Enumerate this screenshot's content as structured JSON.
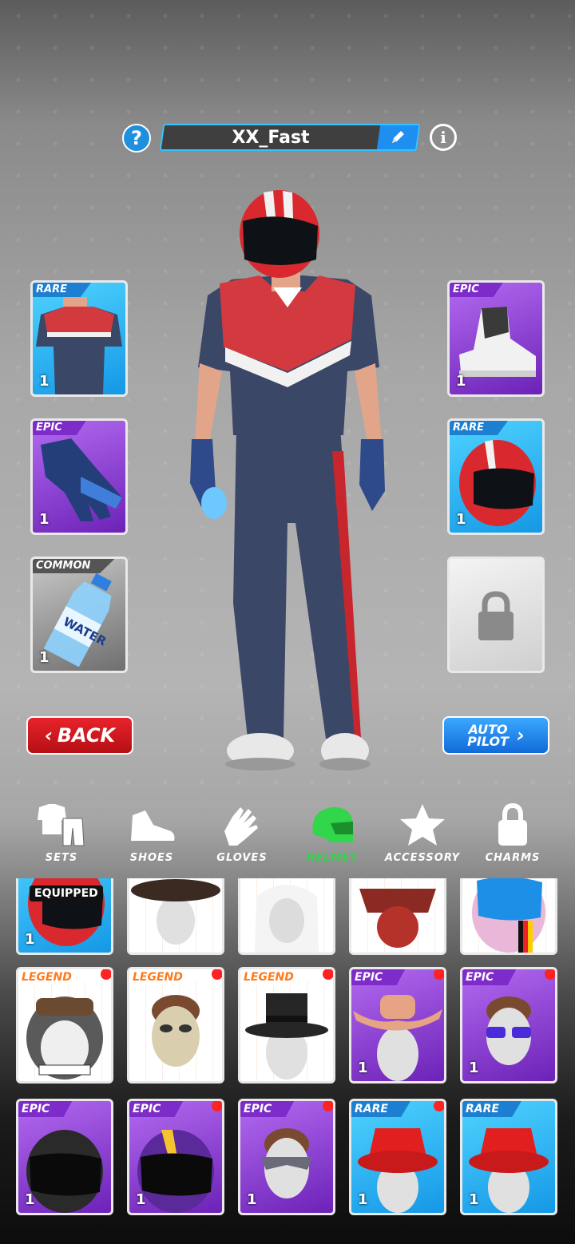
{
  "header": {
    "help_icon": "question-icon",
    "player_name": "XX_Fast",
    "edit_icon": "pencil-icon",
    "info_icon": "info-icon"
  },
  "equipped_slots": {
    "left": [
      {
        "rarity": "RARE",
        "count": "1",
        "item": "racing-suit"
      },
      {
        "rarity": "EPIC",
        "count": "1",
        "item": "glove"
      },
      {
        "rarity": "COMMON",
        "count": "1",
        "item": "water-bottle",
        "bottle_text": "WATER"
      }
    ],
    "right": [
      {
        "rarity": "EPIC",
        "count": "1",
        "item": "sneaker"
      },
      {
        "rarity": "RARE",
        "count": "1",
        "item": "helmet"
      },
      {
        "locked": true,
        "icon": "lock-icon"
      }
    ]
  },
  "buttons": {
    "back": "BACK",
    "autopilot_line1": "AUTO",
    "autopilot_line2": "PILOT"
  },
  "tabs": [
    {
      "label": "SETS",
      "icon": "sets-icon"
    },
    {
      "label": "SHOES",
      "icon": "shoe-icon"
    },
    {
      "label": "GLOVES",
      "icon": "glove-icon"
    },
    {
      "label": "HELMET",
      "icon": "helmet-icon",
      "active": true
    },
    {
      "label": "ACCESSORY",
      "icon": "star-icon"
    },
    {
      "label": "CHARMS",
      "icon": "lock-icon"
    }
  ],
  "colors": {
    "active_tab": "#31d64a",
    "rare": "#1598e6",
    "epic": "#7d2cc9",
    "legend": "#ff7a1a",
    "back": "#e8232a",
    "autopilot": "#1e8ef0"
  },
  "inventory": {
    "row0": [
      {
        "badge": "EQUIPPED",
        "count": "1",
        "item": "red-helmet"
      },
      {
        "item": "black-hat"
      },
      {
        "item": "white-hood"
      },
      {
        "item": "samurai-mask"
      },
      {
        "item": "pink-helmet"
      }
    ],
    "row1": [
      {
        "rarity": "LEGEND",
        "item": "skull-helmet"
      },
      {
        "rarity": "LEGEND",
        "item": "hockey-mask"
      },
      {
        "rarity": "LEGEND",
        "item": "top-hat"
      },
      {
        "rarity": "EPIC",
        "count": "1",
        "item": "cowboy-hat"
      },
      {
        "rarity": "EPIC",
        "count": "1",
        "item": "sunglasses"
      }
    ],
    "row2": [
      {
        "rarity": "EPIC",
        "count": "1",
        "item": "black-helmet"
      },
      {
        "rarity": "EPIC",
        "count": "1",
        "item": "purple-yellow-helmet"
      },
      {
        "rarity": "EPIC",
        "count": "1",
        "item": "eye-mask"
      },
      {
        "rarity": "RARE",
        "count": "1",
        "item": "red-bucket-hat"
      },
      {
        "rarity": "RARE",
        "count": "1",
        "item": "red-bucket-hat"
      }
    ]
  }
}
